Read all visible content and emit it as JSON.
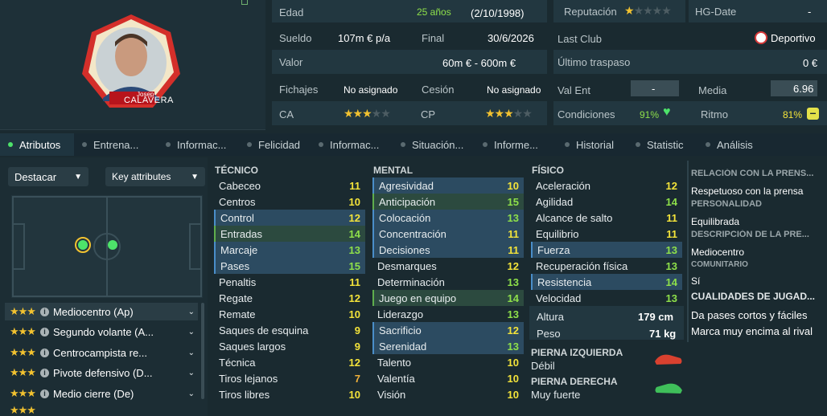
{
  "player": {
    "first_name": "Josep",
    "last_name": "CALAVERA"
  },
  "info": {
    "edad_label": "Edad",
    "edad_value": "25 años",
    "edad_date": "(2/10/1998)",
    "sueldo_label": "Sueldo",
    "sueldo_value": "107m € p/a",
    "final_label": "Final",
    "final_value": "30/6/2026",
    "valor_label": "Valor",
    "valor_value": "60m € - 600m €",
    "fichajes_label": "Fichajes",
    "fichajes_value": "No asignado",
    "cesion_label": "Cesión",
    "cesion_value": "No asignado",
    "ca_label": "CA",
    "ca_stars": 3,
    "cp_label": "CP",
    "cp_stars": 3,
    "reputacion_label": "Reputación",
    "reputacion_stars": 1,
    "hgdate_label": "HG-Date",
    "hgdate_value": "-",
    "lastclub_label": "Last Club",
    "lastclub_value": "Deportivo",
    "ultimo_label": "Último traspaso",
    "ultimo_value": "0 €",
    "valent_label": "Val Ent",
    "valent_value": "-",
    "media_label": "Media",
    "media_value": "6.96",
    "condiciones_label": "Condiciones",
    "condiciones_value": "91%",
    "ritmo_label": "Ritmo",
    "ritmo_value": "81%"
  },
  "tabs": [
    "Atributos",
    "Entrena...",
    "Informac...",
    "Felicidad",
    "Informac...",
    "Situación...",
    "Informe...",
    "Historial",
    "Statistic",
    "Análisis"
  ],
  "left": {
    "destacar_label": "Destacar",
    "key_label": "Key attributes",
    "roles": [
      {
        "name": "Mediocentro (Ap)",
        "stars": 3
      },
      {
        "name": "Segundo volante (A...",
        "stars": 3
      },
      {
        "name": "Centrocampista re...",
        "stars": 3
      },
      {
        "name": "Pivote defensivo (D...",
        "stars": 3
      },
      {
        "name": "Medio cierre (De)",
        "stars": 3
      }
    ]
  },
  "tecnico": {
    "title": "TÉCNICO",
    "items": [
      {
        "n": "Cabeceo",
        "v": "11",
        "hl": ""
      },
      {
        "n": "Centros",
        "v": "10",
        "hl": ""
      },
      {
        "n": "Control",
        "v": "12",
        "hl": "blue"
      },
      {
        "n": "Entradas",
        "v": "14",
        "hl": "green"
      },
      {
        "n": "Marcaje",
        "v": "13",
        "hl": "blue"
      },
      {
        "n": "Pases",
        "v": "15",
        "hl": "blue"
      },
      {
        "n": "Penaltis",
        "v": "11",
        "hl": ""
      },
      {
        "n": "Regate",
        "v": "12",
        "hl": ""
      },
      {
        "n": "Remate",
        "v": "10",
        "hl": ""
      },
      {
        "n": "Saques de esquina",
        "v": "9",
        "hl": ""
      },
      {
        "n": "Saques largos",
        "v": "9",
        "hl": ""
      },
      {
        "n": "Técnica",
        "v": "12",
        "hl": ""
      },
      {
        "n": "Tiros lejanos",
        "v": "7",
        "hl": ""
      },
      {
        "n": "Tiros libres",
        "v": "10",
        "hl": ""
      }
    ]
  },
  "mental": {
    "title": "MENTAL",
    "items": [
      {
        "n": "Agresividad",
        "v": "10",
        "hl": "blue"
      },
      {
        "n": "Anticipación",
        "v": "15",
        "hl": "green"
      },
      {
        "n": "Colocación",
        "v": "13",
        "hl": "blue"
      },
      {
        "n": "Concentración",
        "v": "11",
        "hl": "blue"
      },
      {
        "n": "Decisiones",
        "v": "11",
        "hl": "blue"
      },
      {
        "n": "Desmarques",
        "v": "12",
        "hl": ""
      },
      {
        "n": "Determinación",
        "v": "13",
        "hl": ""
      },
      {
        "n": "Juego en equipo",
        "v": "14",
        "hl": "green"
      },
      {
        "n": "Liderazgo",
        "v": "13",
        "hl": ""
      },
      {
        "n": "Sacrificio",
        "v": "12",
        "hl": "blue"
      },
      {
        "n": "Serenidad",
        "v": "13",
        "hl": "blue"
      },
      {
        "n": "Talento",
        "v": "10",
        "hl": ""
      },
      {
        "n": "Valentía",
        "v": "10",
        "hl": ""
      },
      {
        "n": "Visión",
        "v": "10",
        "hl": ""
      }
    ]
  },
  "fisico": {
    "title": "FÍSICO",
    "items": [
      {
        "n": "Aceleración",
        "v": "12",
        "hl": ""
      },
      {
        "n": "Agilidad",
        "v": "14",
        "hl": ""
      },
      {
        "n": "Alcance de salto",
        "v": "11",
        "hl": ""
      },
      {
        "n": "Equilibrio",
        "v": "11",
        "hl": ""
      },
      {
        "n": "Fuerza",
        "v": "13",
        "hl": "blue"
      },
      {
        "n": "Recuperación física",
        "v": "13",
        "hl": ""
      },
      {
        "n": "Resistencia",
        "v": "14",
        "hl": "blue"
      },
      {
        "n": "Velocidad",
        "v": "13",
        "hl": ""
      }
    ],
    "altura_label": "Altura",
    "altura_value": "179 cm",
    "peso_label": "Peso",
    "peso_value": "71 kg",
    "pierna_izq_label": "PIERNA IZQUIERDA",
    "pierna_izq_value": "Débil",
    "pierna_der_label": "PIERNA DERECHA",
    "pierna_der_value": "Muy fuerte"
  },
  "right": {
    "rel_title": "RELACIÓN CON LA PRENS...",
    "rel_value": "Respetuoso con la prensa",
    "pers_title": "PERSONALIDAD",
    "pers_value": "Equilibrada",
    "desc_title": "DESCRIPCIÓN DE LA PRE...",
    "desc_value": "Mediocentro",
    "com_title": "COMUNITARIO",
    "com_value": "Sí",
    "cual_title": "CUALIDADES DE JUGAD...",
    "cual_1": "Da pases cortos y fáciles",
    "cual_2": "Marca muy encima al rival"
  },
  "colors": {
    "green": "#8ee04a",
    "yellow": "#f3e33a",
    "star": "#f2c230",
    "highlight_blue": "#2c4b61",
    "highlight_green": "#2c4a3f"
  }
}
